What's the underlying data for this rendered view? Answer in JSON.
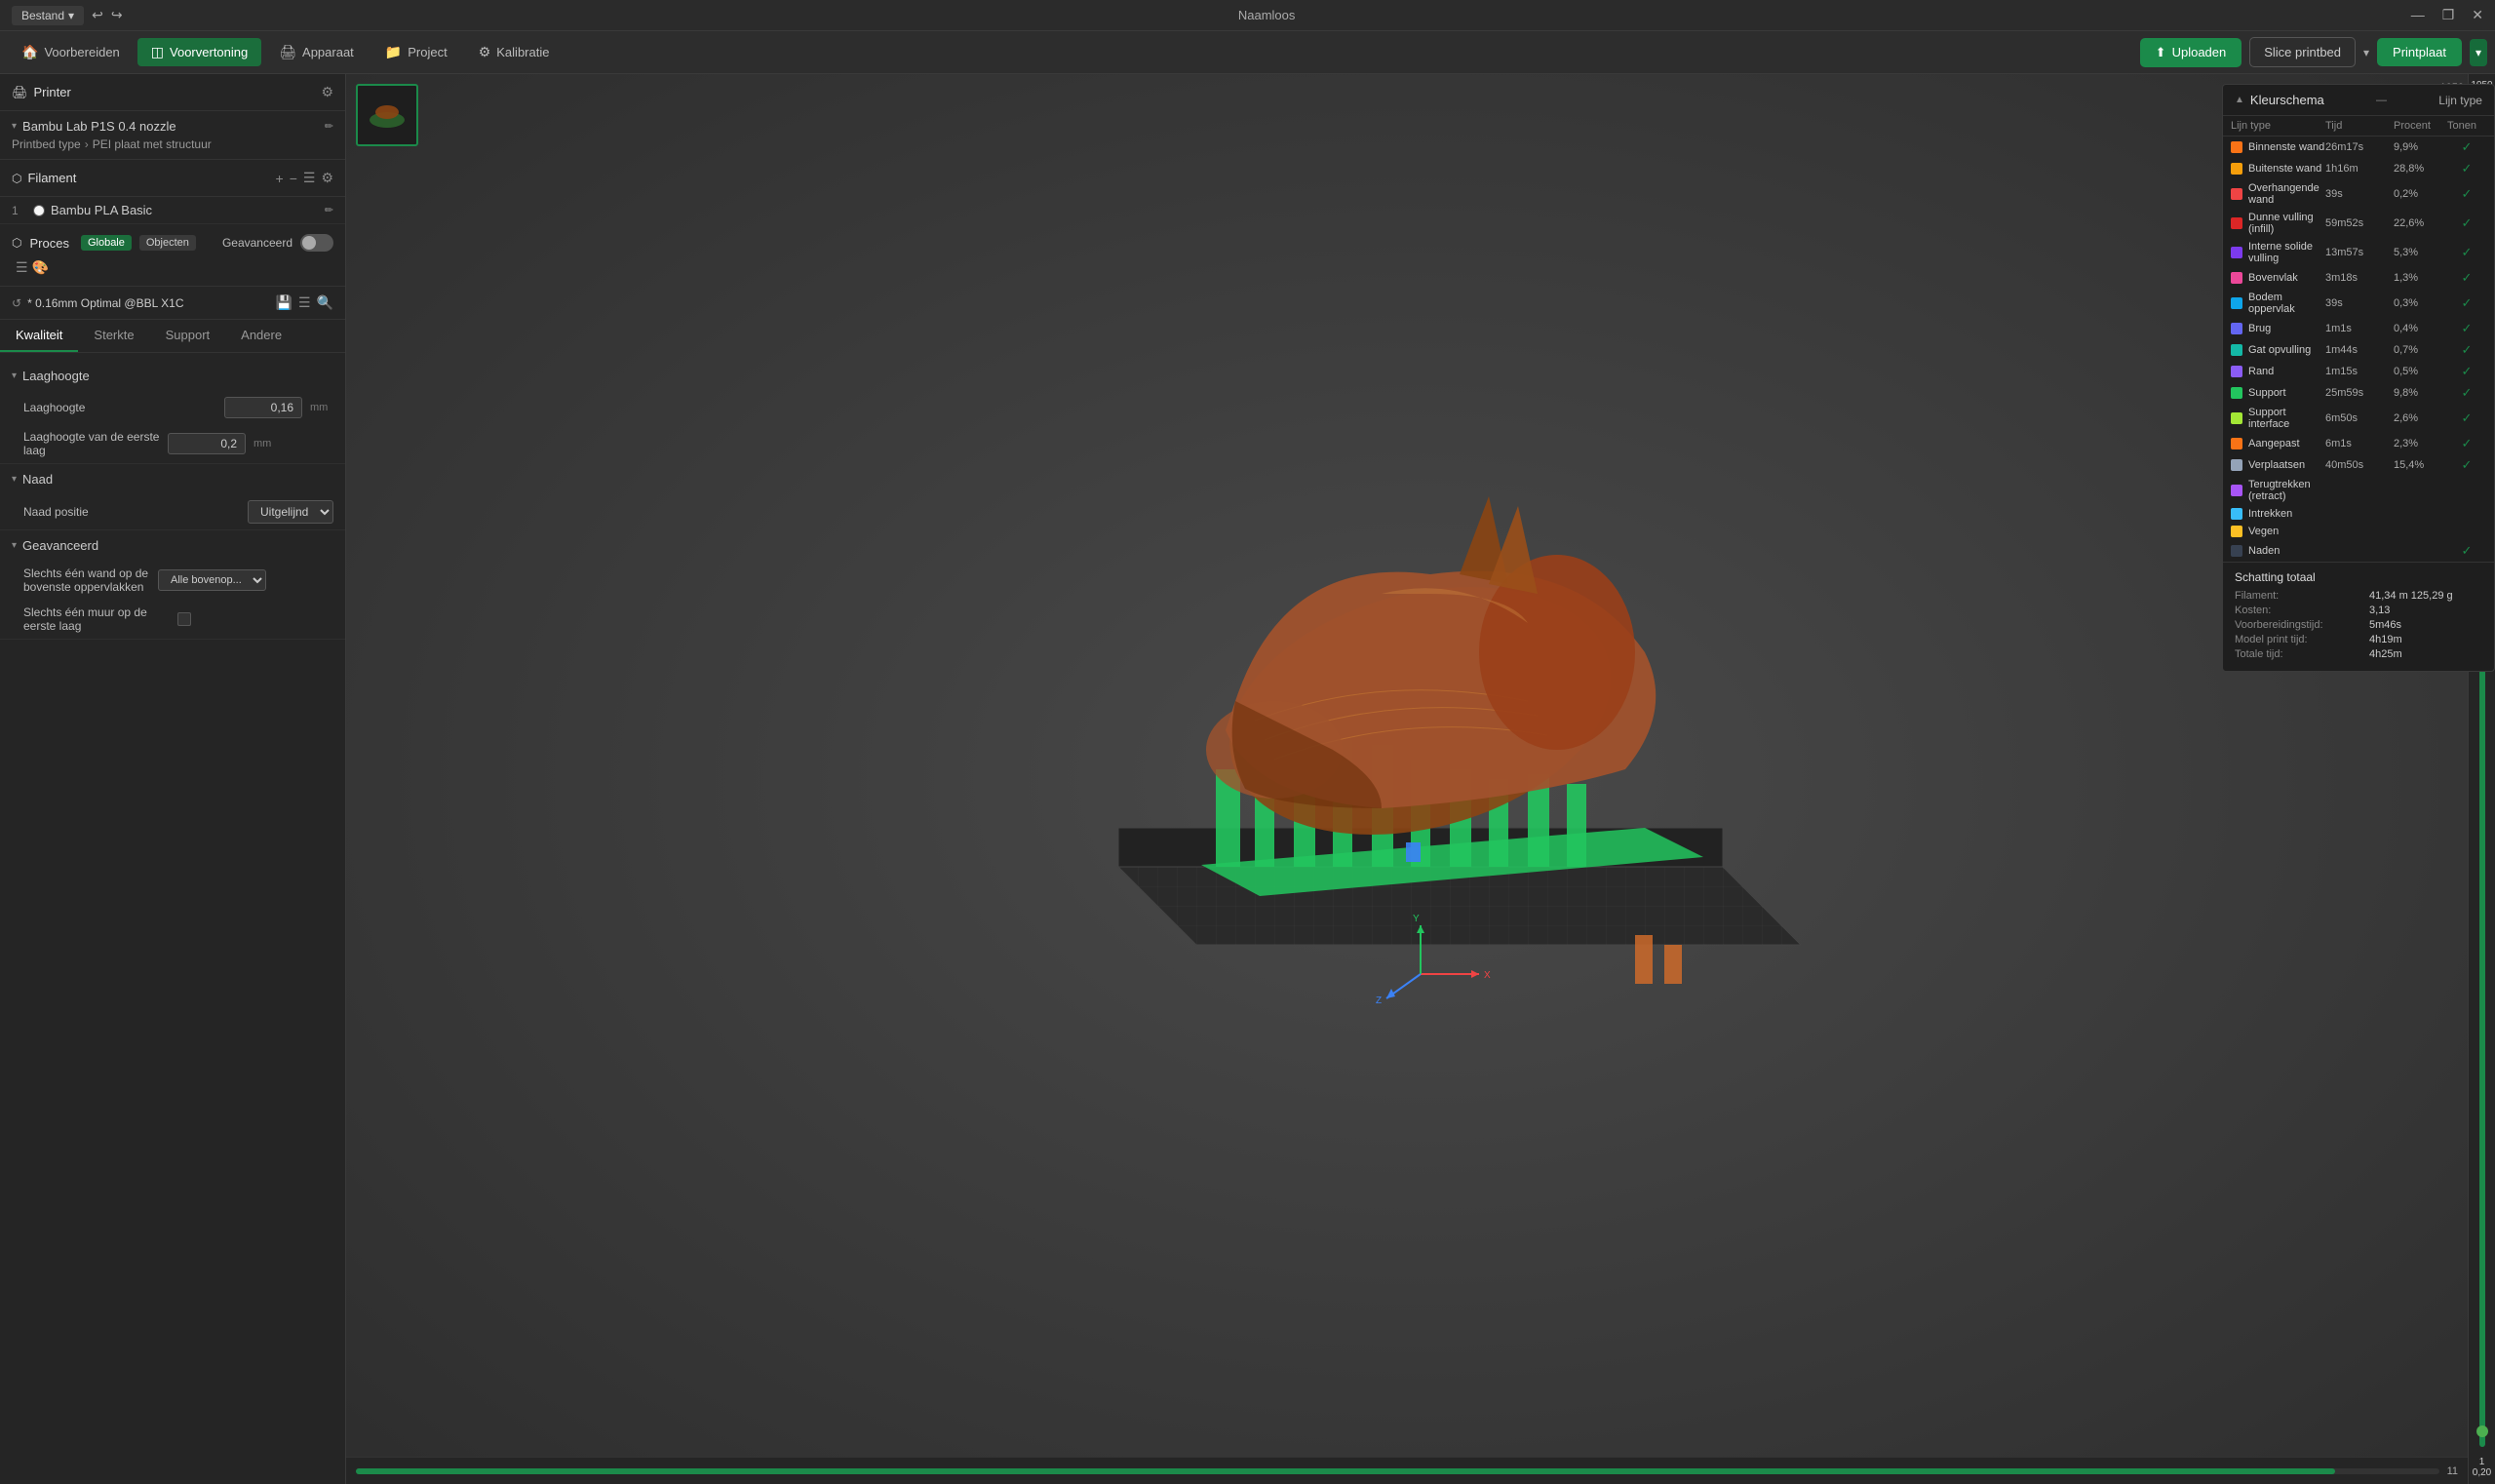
{
  "app": {
    "title": "Naamloos",
    "bestand_label": "Bestand"
  },
  "titlebar": {
    "min": "—",
    "max": "❐",
    "close": "✕"
  },
  "nav": {
    "items": [
      {
        "id": "voorbereiden",
        "label": "Voorbereiden",
        "icon": "🏠",
        "active": false
      },
      {
        "id": "voorvertoning",
        "label": "Voorvertoning",
        "icon": "◫",
        "active": true
      },
      {
        "id": "apparaat",
        "label": "Apparaat",
        "icon": "🖨",
        "active": false
      },
      {
        "id": "project",
        "label": "Project",
        "icon": "📁",
        "active": false
      },
      {
        "id": "kalibratie",
        "label": "Kalibratie",
        "icon": "⚙",
        "active": false
      }
    ],
    "upload_label": "Uploaden",
    "slice_label": "Slice printbed",
    "print_label": "Printplaat"
  },
  "left_panel": {
    "printer_section_title": "Printer",
    "printer_name": "Bambu Lab P1S 0.4 nozzle",
    "printbed_type_label": "Printbed type",
    "printbed_type_value": "PEI plaat met structuur",
    "filament_section_title": "Filament",
    "filament_item": {
      "number": "1",
      "name": "Bambu PLA Basic"
    },
    "process_title": "Proces",
    "process_badge_global": "Globale",
    "process_badge_objects": "Objecten",
    "process_advanced": "Geavanceerd",
    "profile_name": "* 0.16mm Optimal @BBL X1C",
    "tabs": [
      "Kwaliteit",
      "Sterkte",
      "Support",
      "Andere"
    ],
    "active_tab": "Kwaliteit",
    "section_laagHoogte": {
      "title": "Laaghoogte",
      "fields": [
        {
          "label": "Laaghoogte",
          "value": "0,16",
          "unit": "mm"
        },
        {
          "label": "Laaghoogte van de eerste laag",
          "value": "0,2",
          "unit": "mm"
        }
      ]
    },
    "section_naad": {
      "title": "Naad",
      "fields": [
        {
          "label": "Naad positie",
          "value": "Uitgelijnd",
          "type": "select"
        }
      ]
    },
    "section_geavanceerd": {
      "title": "Geavanceerd",
      "fields": [
        {
          "label": "Slechts één wand op de bovenste oppervlakken",
          "value": "Alle bovenop...",
          "type": "select"
        },
        {
          "label": "Slechts één muur op de eerste laag",
          "value": "",
          "type": "checkbox"
        }
      ]
    }
  },
  "color_panel": {
    "title": "Kleurschema",
    "subtitle": "Lijn type",
    "columns": {
      "type": "Lijn type",
      "time": "Tijd",
      "percent": "Procent",
      "show": "Tonen"
    },
    "rows": [
      {
        "name": "Binnenste wand",
        "color": "#f97316",
        "time": "26m17s",
        "percent": "9,9%",
        "checked": true
      },
      {
        "name": "Buitenste wand",
        "color": "#f59e0b",
        "time": "1h16m",
        "percent": "28,8%",
        "checked": true
      },
      {
        "name": "Overhangende wand",
        "color": "#ef4444",
        "time": "39s",
        "percent": "0,2%",
        "checked": true
      },
      {
        "name": "Dunne vulling (infill)",
        "color": "#dc2626",
        "time": "59m52s",
        "percent": "22,6%",
        "checked": true
      },
      {
        "name": "Interne solide vulling",
        "color": "#7c3aed",
        "time": "13m57s",
        "percent": "5,3%",
        "checked": true
      },
      {
        "name": "Bovenvlak",
        "color": "#ec4899",
        "time": "3m18s",
        "percent": "1,3%",
        "checked": true
      },
      {
        "name": "Bodem oppervlak",
        "color": "#0ea5e9",
        "time": "39s",
        "percent": "0,3%",
        "checked": true
      },
      {
        "name": "Brug",
        "color": "#6366f1",
        "time": "1m1s",
        "percent": "0,4%",
        "checked": true
      },
      {
        "name": "Gat opvulling",
        "color": "#14b8a6",
        "time": "1m44s",
        "percent": "0,7%",
        "checked": true
      },
      {
        "name": "Rand",
        "color": "#8b5cf6",
        "time": "1m15s",
        "percent": "0,5%",
        "checked": true
      },
      {
        "name": "Support",
        "color": "#22c55e",
        "time": "25m59s",
        "percent": "9,8%",
        "checked": true
      },
      {
        "name": "Support interface",
        "color": "#a3e635",
        "time": "6m50s",
        "percent": "2,6%",
        "checked": true
      },
      {
        "name": "Aangepast",
        "color": "#f97316",
        "time": "6m1s",
        "percent": "2,3%",
        "checked": true
      },
      {
        "name": "Verplaatsen",
        "color": "#94a3b8",
        "time": "40m50s",
        "percent": "15,4%",
        "checked": true
      },
      {
        "name": "Terugtrekken (retract)",
        "color": "#a855f7",
        "time": "",
        "percent": "",
        "checked": false
      },
      {
        "name": "Intrekken",
        "color": "#38bdf8",
        "time": "",
        "percent": "",
        "checked": false
      },
      {
        "name": "Vegen",
        "color": "#fbbf24",
        "time": "",
        "percent": "",
        "checked": false
      },
      {
        "name": "Naden",
        "color": "#374151",
        "time": "",
        "percent": "",
        "checked": true
      }
    ],
    "estimates_title": "Schatting totaal",
    "estimates": [
      {
        "label": "Filament:",
        "value": "41,34 m   125,29 g"
      },
      {
        "label": "Kosten:",
        "value": "3,13"
      },
      {
        "label": "Voorbereidingstijd:",
        "value": "5m46s"
      },
      {
        "label": "Model print tijd:",
        "value": "4h19m"
      },
      {
        "label": "Totale tijd:",
        "value": "4h25m"
      }
    ]
  },
  "viewport": {
    "layer_current": "11",
    "layer_total": "11",
    "slider_top_value": "1050",
    "slider_top_value2": "101,32",
    "slider_bottom_value": "1",
    "slider_bottom_value2": "0,20"
  }
}
